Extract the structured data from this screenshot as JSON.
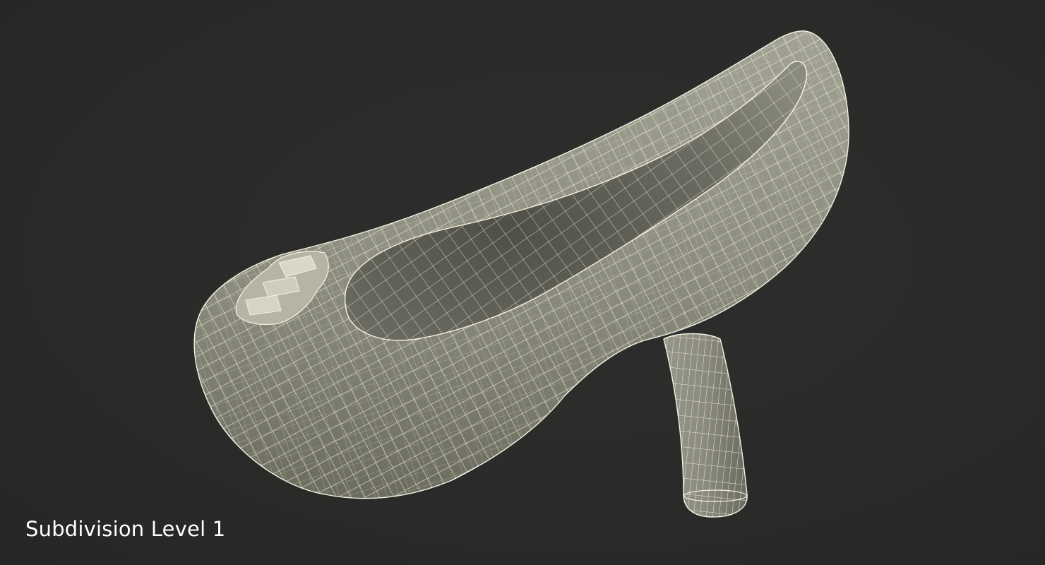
{
  "caption": "Subdivision Level 1",
  "colors": {
    "background": "#2a2a29",
    "surface": "#8c8c7e",
    "surface_shadow": "#5d5d52",
    "inner": "#66665c",
    "wire": "#f2f2e0"
  }
}
